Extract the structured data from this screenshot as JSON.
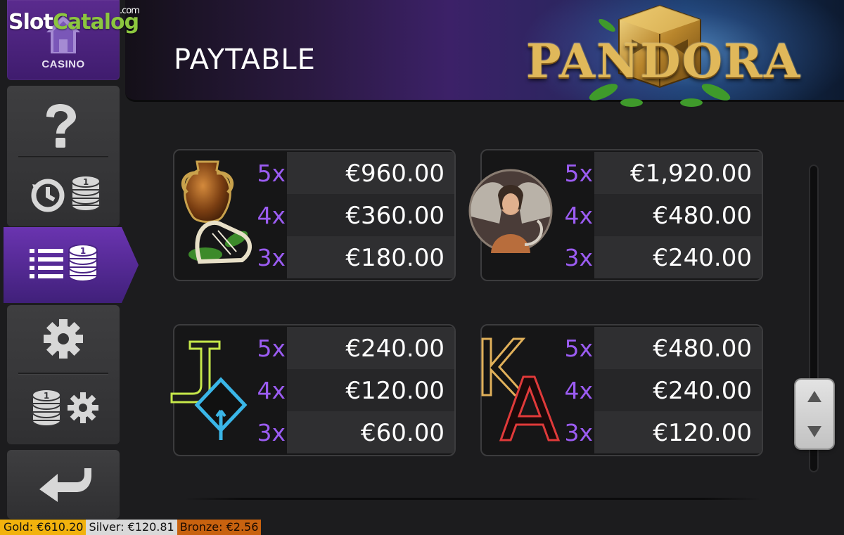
{
  "watermark": {
    "brand_a": "Slot",
    "brand_b": "Catalog",
    "suffix": ".com"
  },
  "sidebar": {
    "casino_label": "CASINO",
    "items": [
      {
        "name": "help",
        "icon": "question-icon"
      },
      {
        "name": "history",
        "icon": "history-coins-icon"
      },
      {
        "name": "paytable",
        "icon": "paytable-list-icon",
        "active": true
      },
      {
        "name": "settings",
        "icon": "gear-icon"
      },
      {
        "name": "bet-settings",
        "icon": "coins-gear-icon"
      },
      {
        "name": "back",
        "icon": "return-arrow-icon"
      }
    ]
  },
  "header": {
    "title": "PAYTABLE",
    "logo_text": "PANDORA"
  },
  "paytable": [
    {
      "symbol": "amphora-lyre-icon",
      "rows": [
        {
          "mult": "5x",
          "value": "€960.00"
        },
        {
          "mult": "4x",
          "value": "€360.00"
        },
        {
          "mult": "3x",
          "value": "€180.00"
        }
      ]
    },
    {
      "symbol": "winged-woman-icon",
      "rows": [
        {
          "mult": "5x",
          "value": "€1,920.00"
        },
        {
          "mult": "4x",
          "value": "€480.00"
        },
        {
          "mult": "3x",
          "value": "€240.00"
        }
      ]
    },
    {
      "symbol": "j-q-letters-icon",
      "rows": [
        {
          "mult": "5x",
          "value": "€240.00"
        },
        {
          "mult": "4x",
          "value": "€120.00"
        },
        {
          "mult": "3x",
          "value": "€60.00"
        }
      ]
    },
    {
      "symbol": "k-a-letters-icon",
      "rows": [
        {
          "mult": "5x",
          "value": "€480.00"
        },
        {
          "mult": "4x",
          "value": "€240.00"
        },
        {
          "mult": "3x",
          "value": "€120.00"
        }
      ]
    }
  ],
  "jackpots": {
    "gold": "Gold: €610.20",
    "silver": "Silver: €120.81",
    "bronze": "Bronze: €2.56"
  },
  "colors": {
    "accent_purple": "#9b5cf2",
    "gold": "#f2b20d",
    "silver": "#d9d9d9",
    "bronze": "#c8620f"
  }
}
